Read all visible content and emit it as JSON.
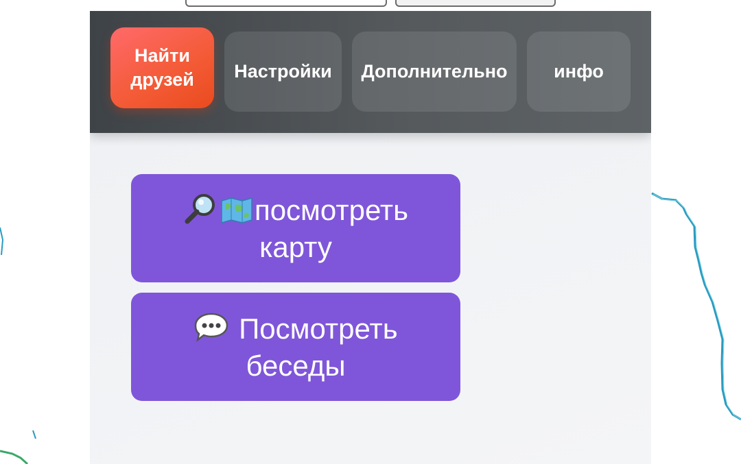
{
  "nav": {
    "items": [
      {
        "label_line1": "Найти",
        "label_line2": "друзей",
        "active": true
      },
      {
        "label": "Настройки",
        "active": false
      },
      {
        "label": "Дополнительно",
        "active": false
      },
      {
        "label": "инфо",
        "active": false
      }
    ]
  },
  "actions": {
    "view_map": {
      "label_line1": "посмотреть",
      "label_line2": "карту",
      "icons": [
        "magnifier-icon",
        "world-map-icon"
      ]
    },
    "view_chats": {
      "label_line1": "Посмотреть",
      "label_line2": "беседы",
      "icons": [
        "speech-bubble-icon"
      ]
    }
  },
  "colors": {
    "navbar_dark": "#3e4347",
    "active_tab": "#f35a35",
    "action_button": "#7f56d9",
    "panel_bg": "#f0f2f4",
    "map_line": "#2a9bc0"
  }
}
